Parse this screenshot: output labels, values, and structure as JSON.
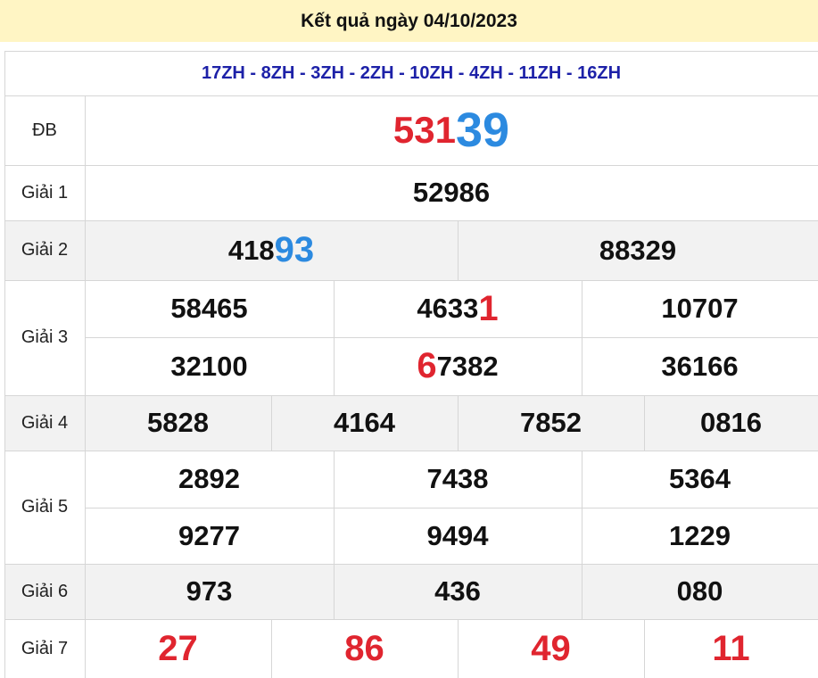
{
  "title": "Kết quả ngày 04/10/2023",
  "codes": "17ZH - 8ZH - 3ZH - 2ZH - 10ZH - 4ZH - 11ZH - 16ZH",
  "colors": {
    "title_bg": "#fff5c4",
    "codes": "#1d21a8",
    "red": "#e0252f",
    "blue": "#2c8ae0"
  },
  "prizes": {
    "db": {
      "label": "ĐB",
      "head": "531",
      "tail": "39"
    },
    "g1": {
      "label": "Giải 1",
      "value": "52986"
    },
    "g2": {
      "label": "Giải 2",
      "n1_head": "418",
      "n1_tail": "93",
      "n2": "88329"
    },
    "g3": {
      "label": "Giải 3",
      "n1": "58465",
      "n2_head": "4633",
      "n2_tail": "1",
      "n3": "10707",
      "n4": "32100",
      "n5_head": "6",
      "n5_tail": "7382",
      "n6": "36166"
    },
    "g4": {
      "label": "Giải 4",
      "values": [
        "5828",
        "4164",
        "7852",
        "0816"
      ]
    },
    "g5": {
      "label": "Giải 5",
      "values": [
        "2892",
        "7438",
        "5364",
        "9277",
        "9494",
        "1229"
      ]
    },
    "g6": {
      "label": "Giải 6",
      "values": [
        "973",
        "436",
        "080"
      ]
    },
    "g7": {
      "label": "Giải 7",
      "values": [
        "27",
        "86",
        "49",
        "11"
      ]
    }
  }
}
